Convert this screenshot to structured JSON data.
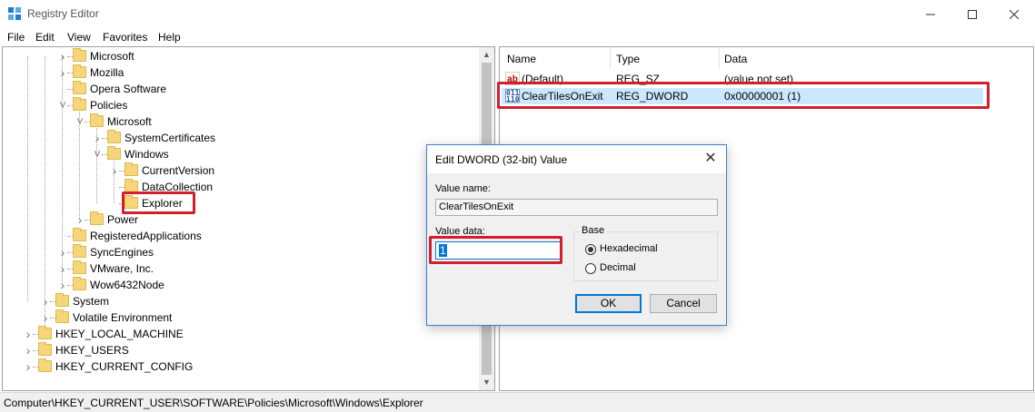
{
  "window": {
    "title": "Registry Editor"
  },
  "menu": [
    "File",
    "Edit",
    "View",
    "Favorites",
    "Help"
  ],
  "tree": [
    {
      "label": "Microsoft",
      "expand": "collapsed"
    },
    {
      "label": "Mozilla",
      "expand": "collapsed"
    },
    {
      "label": "Opera Software",
      "expand": "none"
    },
    {
      "label": "Policies",
      "expand": "expanded"
    },
    {
      "label": "Microsoft",
      "expand": "expanded"
    },
    {
      "label": "SystemCertificates",
      "expand": "collapsed"
    },
    {
      "label": "Windows",
      "expand": "expanded"
    },
    {
      "label": "CurrentVersion",
      "expand": "collapsed"
    },
    {
      "label": "DataCollection",
      "expand": "none"
    },
    {
      "label": "Explorer",
      "expand": "none",
      "selected": true
    },
    {
      "label": "Power",
      "expand": "collapsed"
    },
    {
      "label": "RegisteredApplications",
      "expand": "none"
    },
    {
      "label": "SyncEngines",
      "expand": "collapsed"
    },
    {
      "label": "VMware, Inc.",
      "expand": "collapsed"
    },
    {
      "label": "Wow6432Node",
      "expand": "collapsed"
    },
    {
      "label": "System",
      "expand": "collapsed"
    },
    {
      "label": "Volatile Environment",
      "expand": "collapsed"
    },
    {
      "label": "HKEY_LOCAL_MACHINE",
      "expand": "collapsed"
    },
    {
      "label": "HKEY_USERS",
      "expand": "collapsed"
    },
    {
      "label": "HKEY_CURRENT_CONFIG",
      "expand": "collapsed"
    }
  ],
  "list": {
    "headers": {
      "name": "Name",
      "type": "Type",
      "data": "Data"
    },
    "rows": [
      {
        "icon": "string-value-icon",
        "icon_text": "ab",
        "name": "(Default)",
        "type": "REG_SZ",
        "data": "(value not set)",
        "selected": false
      },
      {
        "icon": "dword-value-icon",
        "icon_text": "011 110",
        "name": "ClearTilesOnExit",
        "type": "REG_DWORD",
        "data": "0x00000001 (1)",
        "selected": true
      }
    ]
  },
  "dialog": {
    "title": "Edit DWORD (32-bit) Value",
    "value_name_label": "Value name:",
    "value_name": "ClearTilesOnExit",
    "value_data_label": "Value data:",
    "value_data": "1",
    "base_label": "Base",
    "base_options": [
      "Hexadecimal",
      "Decimal"
    ],
    "base_selected": "Hexadecimal",
    "ok_label": "OK",
    "cancel_label": "Cancel"
  },
  "status": {
    "path": "Computer\\HKEY_CURRENT_USER\\SOFTWARE\\Policies\\Microsoft\\Windows\\Explorer"
  },
  "colors": {
    "highlight": "#d0202c",
    "selection": "#cce8ff",
    "accent": "#0078d7",
    "folder": "#f6d67a"
  }
}
